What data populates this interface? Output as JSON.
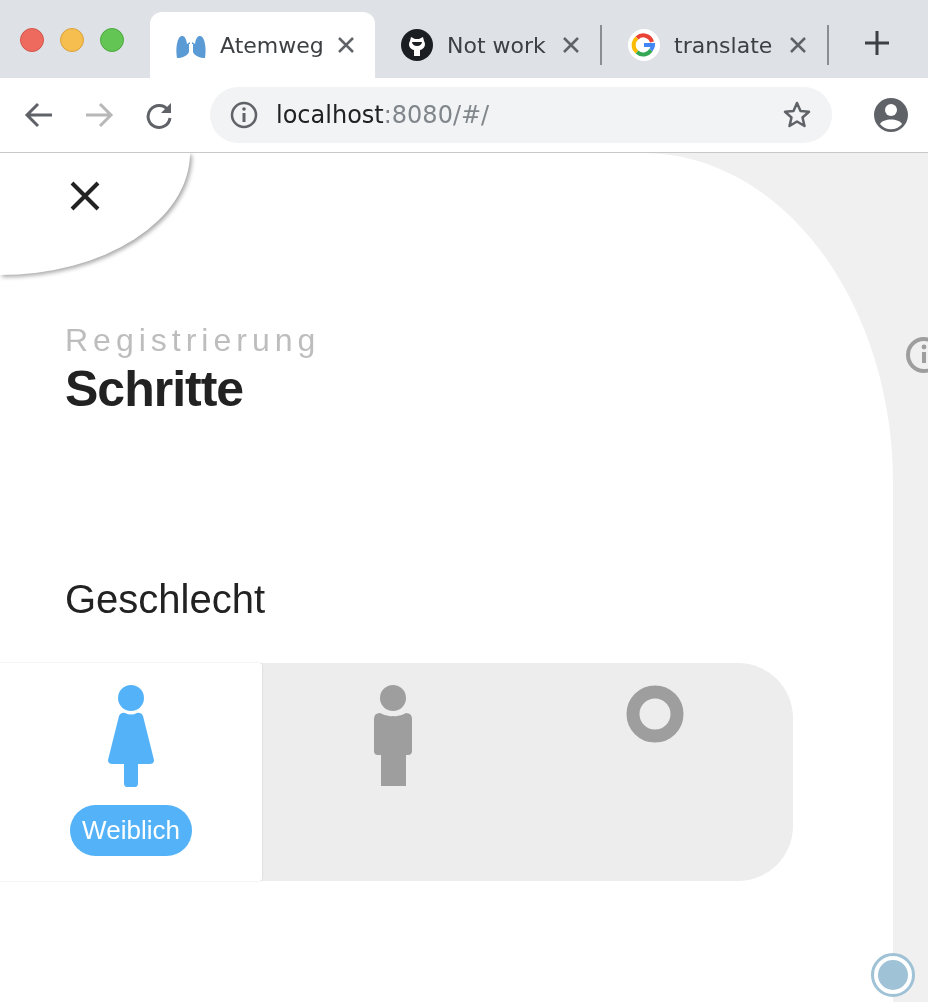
{
  "browser": {
    "tabs": [
      {
        "title": "Atemweg",
        "kind": "lungs",
        "selected": true
      },
      {
        "title": "Not work",
        "kind": "octocat",
        "selected": false
      },
      {
        "title": "translate",
        "kind": "google",
        "selected": false
      }
    ],
    "back_disabled": false,
    "forward_disabled": true,
    "address": {
      "host": "localhost",
      "rest": ":8080/#/"
    }
  },
  "page": {
    "eyebrow": "Registrierung",
    "title": "Schritte",
    "field_label": "Geschlecht",
    "gender_options": [
      {
        "kind": "female",
        "selected": true,
        "label": "Weiblich"
      },
      {
        "kind": "male",
        "selected": false
      },
      {
        "kind": "diverse",
        "selected": false
      }
    ]
  }
}
